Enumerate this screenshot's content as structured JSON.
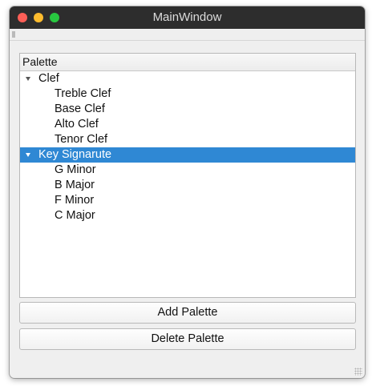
{
  "window": {
    "title": "MainWindow",
    "controls": [
      "close",
      "minimize",
      "maximize"
    ]
  },
  "tree": {
    "header": "Palette",
    "groups": [
      {
        "label": "Clef",
        "expanded": true,
        "selected": false,
        "children": [
          "Treble Clef",
          "Base Clef",
          "Alto Clef",
          "Tenor Clef"
        ]
      },
      {
        "label": "Key Signarute",
        "expanded": true,
        "selected": true,
        "children": [
          "G Minor",
          "B Major",
          "F Minor",
          "C Major"
        ]
      }
    ]
  },
  "buttons": {
    "add": "Add Palette",
    "delete": "Delete Palette"
  },
  "colors": {
    "titlebar": "#2d2d2d",
    "selection": "#2f88d4",
    "close": "#fe5f57",
    "minimize": "#febc2e",
    "maximize": "#28c840"
  }
}
